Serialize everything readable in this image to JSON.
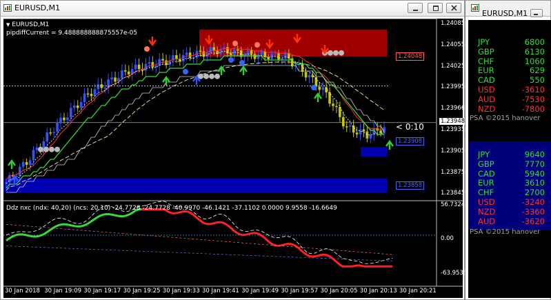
{
  "main_window": {
    "title": "EURUSD,M1"
  },
  "chart": {
    "symbol_label": "EURUSD,M1",
    "info_line": "pipdiffCurrent = 9.488888888875557e-05",
    "countdown": "< 0:10",
    "price_scale": [
      "1.24085",
      "1.24055",
      "1.24025",
      "1.23995",
      "1.23966",
      "1.23935",
      "1.23905",
      "1.23875",
      "1.23845"
    ],
    "current_price": "1.23948",
    "level_labels": [
      "1.24048",
      "1.23908",
      "1.23858"
    ],
    "indicator_label": "Ddz nxc (ndx: 40,20) (ncs: 20,10) -24.7728 -24.7728 -40.9970 -46.1421 -37.1102 0.0000 9.9558 -16.6649",
    "indicator_scale": [
      "56.7324",
      "0.00",
      "-63.9535"
    ],
    "time_axis": [
      "30 Jan 2018",
      "30 Jan 19:09",
      "30 Jan 19:17",
      "30 Jan 19:25",
      "30 Jan 19:33",
      "30 Jan 19:41",
      "30 Jan 19:49",
      "30 Jan 19:57",
      "30 Jan 20:05",
      "30 Jan 20:13",
      "30 Jan 20:21"
    ]
  },
  "side_window": {
    "title": "EURUSD,M1",
    "panel1": [
      {
        "cur": "JPY",
        "val": "6800",
        "color": "#33dd33"
      },
      {
        "cur": "GBP",
        "val": "6130",
        "color": "#33dd33"
      },
      {
        "cur": "CHF",
        "val": "1060",
        "color": "#33dd33"
      },
      {
        "cur": "EUR",
        "val": "629",
        "color": "#33dd33"
      },
      {
        "cur": "CAD",
        "val": "550",
        "color": "#33dd33"
      },
      {
        "cur": "USD",
        "val": "-3610",
        "color": "#ff3030"
      },
      {
        "cur": "AUD",
        "val": "-7530",
        "color": "#ff3030"
      },
      {
        "cur": "NZD",
        "val": "-7800",
        "color": "#ff3030"
      }
    ],
    "panel1_footer": "PSA ©2015 hanover",
    "panel2": [
      {
        "cur": "JPY",
        "val": "9640",
        "color": "#33dd33"
      },
      {
        "cur": "GBP",
        "val": "7770",
        "color": "#33dd33"
      },
      {
        "cur": "CAD",
        "val": "5940",
        "color": "#33dd33"
      },
      {
        "cur": "EUR",
        "val": "3610",
        "color": "#33dd33"
      },
      {
        "cur": "CHF",
        "val": "2700",
        "color": "#33dd33"
      },
      {
        "cur": "USD",
        "val": "-3240",
        "color": "#ff3030"
      },
      {
        "cur": "NZD",
        "val": "-3360",
        "color": "#ff3030"
      },
      {
        "cur": "AUD",
        "val": "-3620",
        "color": "#ff3030"
      }
    ],
    "panel2_footer": "PSA ©2015 hanover"
  },
  "colors": {
    "bull_candle": "#2f55ff",
    "bear_candle": "#c8c800",
    "up_arrow": "#33cc33",
    "down_arrow": "#ff3300",
    "resistance_zone": "#a00000",
    "support_zone": "#0000b0"
  }
}
